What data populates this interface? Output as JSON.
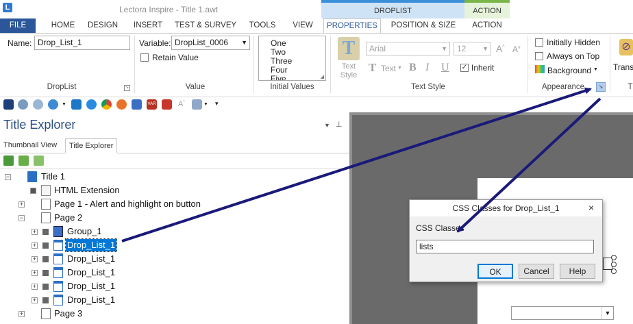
{
  "window": {
    "title": "Lectora Inspire - Title 1.awt",
    "app_icon": "L"
  },
  "context_tabs": {
    "droplist": "DROPLIST",
    "action": "ACTION"
  },
  "tabs": [
    "FILE",
    "HOME",
    "DESIGN",
    "INSERT",
    "TEST & SURVEY",
    "TOOLS",
    "VIEW",
    "PROPERTIES",
    "POSITION & SIZE",
    "ACTION"
  ],
  "ribbon": {
    "droplist": {
      "name_label": "Name:",
      "name_value": "Drop_List_1",
      "group_label": "DropList"
    },
    "value": {
      "variable_label": "Variable:",
      "variable_value": "DropList_0006",
      "retain_label": "Retain Value",
      "group_label": "Value"
    },
    "initial_values": {
      "items": [
        "One",
        "Two",
        "Three",
        "Four",
        "Five"
      ],
      "group_label": "Initial Values"
    },
    "text_style": {
      "text_style_label": "Text Style",
      "font": "Arial",
      "size": "12",
      "text_label": "Text",
      "bold": "B",
      "italic": "I",
      "underline": "U",
      "inherit_label": "Inherit",
      "group_label": "Text Style"
    },
    "appearance": {
      "initially_hidden": "Initially Hidden",
      "always_on_top": "Always on Top",
      "background": "Background",
      "group_label": "Appearance"
    },
    "transitions": {
      "label": "Transi",
      "group_label": "T"
    }
  },
  "explorer": {
    "title": "Title Explorer",
    "tabs": [
      "Thumbnail View",
      "Title Explorer"
    ],
    "tree": [
      {
        "label": "Title 1"
      },
      {
        "label": "HTML Extension"
      },
      {
        "label": "Page 1 - Alert and highlight on button"
      },
      {
        "label": "Page 2"
      },
      {
        "label": "Group_1"
      },
      {
        "label": "Drop_List_1"
      },
      {
        "label": "Drop_List_1"
      },
      {
        "label": "Drop_List_1"
      },
      {
        "label": "Drop_List_1"
      },
      {
        "label": "Drop_List_1"
      },
      {
        "label": "Page 3"
      }
    ]
  },
  "dialog": {
    "title": "CSS Classes for Drop_List_1",
    "field_label": "CSS Classes",
    "field_value": "lists",
    "ok": "OK",
    "cancel": "Cancel",
    "help": "Help"
  },
  "colors": {
    "file_tab": "#2b579a",
    "selection": "#0078d7",
    "arrow": "#1a1a7a",
    "accent": "#3a8fd8"
  }
}
